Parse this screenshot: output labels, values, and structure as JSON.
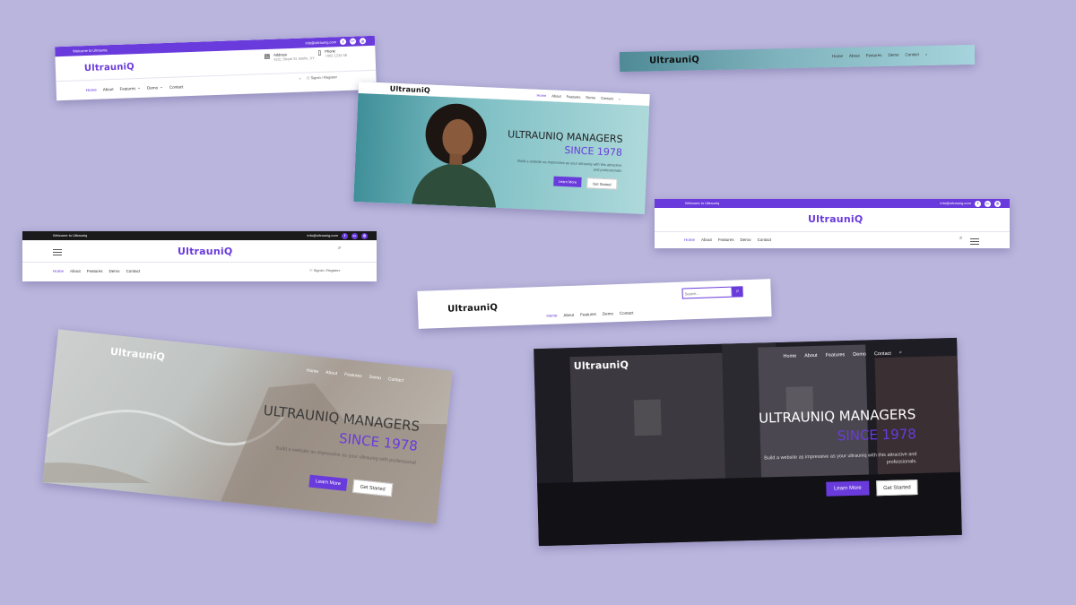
{
  "brand": "UltrauniQ",
  "welcome": "Welcome to Ultrauniq",
  "email": "info@ultraunig.com",
  "nav": [
    "Home",
    "About",
    "Features",
    "Demo",
    "Contact"
  ],
  "login": "Signin / Register",
  "address_label": "Address",
  "address_value": "42/2, Street St. Berlin, XY",
  "phone_label": "Phone",
  "phone_value": "+002 1234 56",
  "search_placeholder": "Search...",
  "hero": {
    "title": "ULTRAUNIQ MANAGERS",
    "since": "SINCE 1978",
    "desc_a": "Build a website as impressive as your ultrauniq with this attractive and professionals",
    "desc_b": "Build a website as impressive as your ultrauniq with professional",
    "desc_c": "Build a website as impressive as your ultrauniq with this attractive and professionals.",
    "learn_more": "Learn More",
    "get_started": "Get Started"
  },
  "icons": {
    "facebook": "f",
    "googleplus": "G+",
    "instagram": "◎",
    "search": "⌕",
    "map": "🗺",
    "mobile": "📱",
    "user": "👤"
  },
  "colors": {
    "background": "#b9b5dd",
    "accent": "#6a3bdc",
    "topbar_dark": "#1a1a1a"
  }
}
